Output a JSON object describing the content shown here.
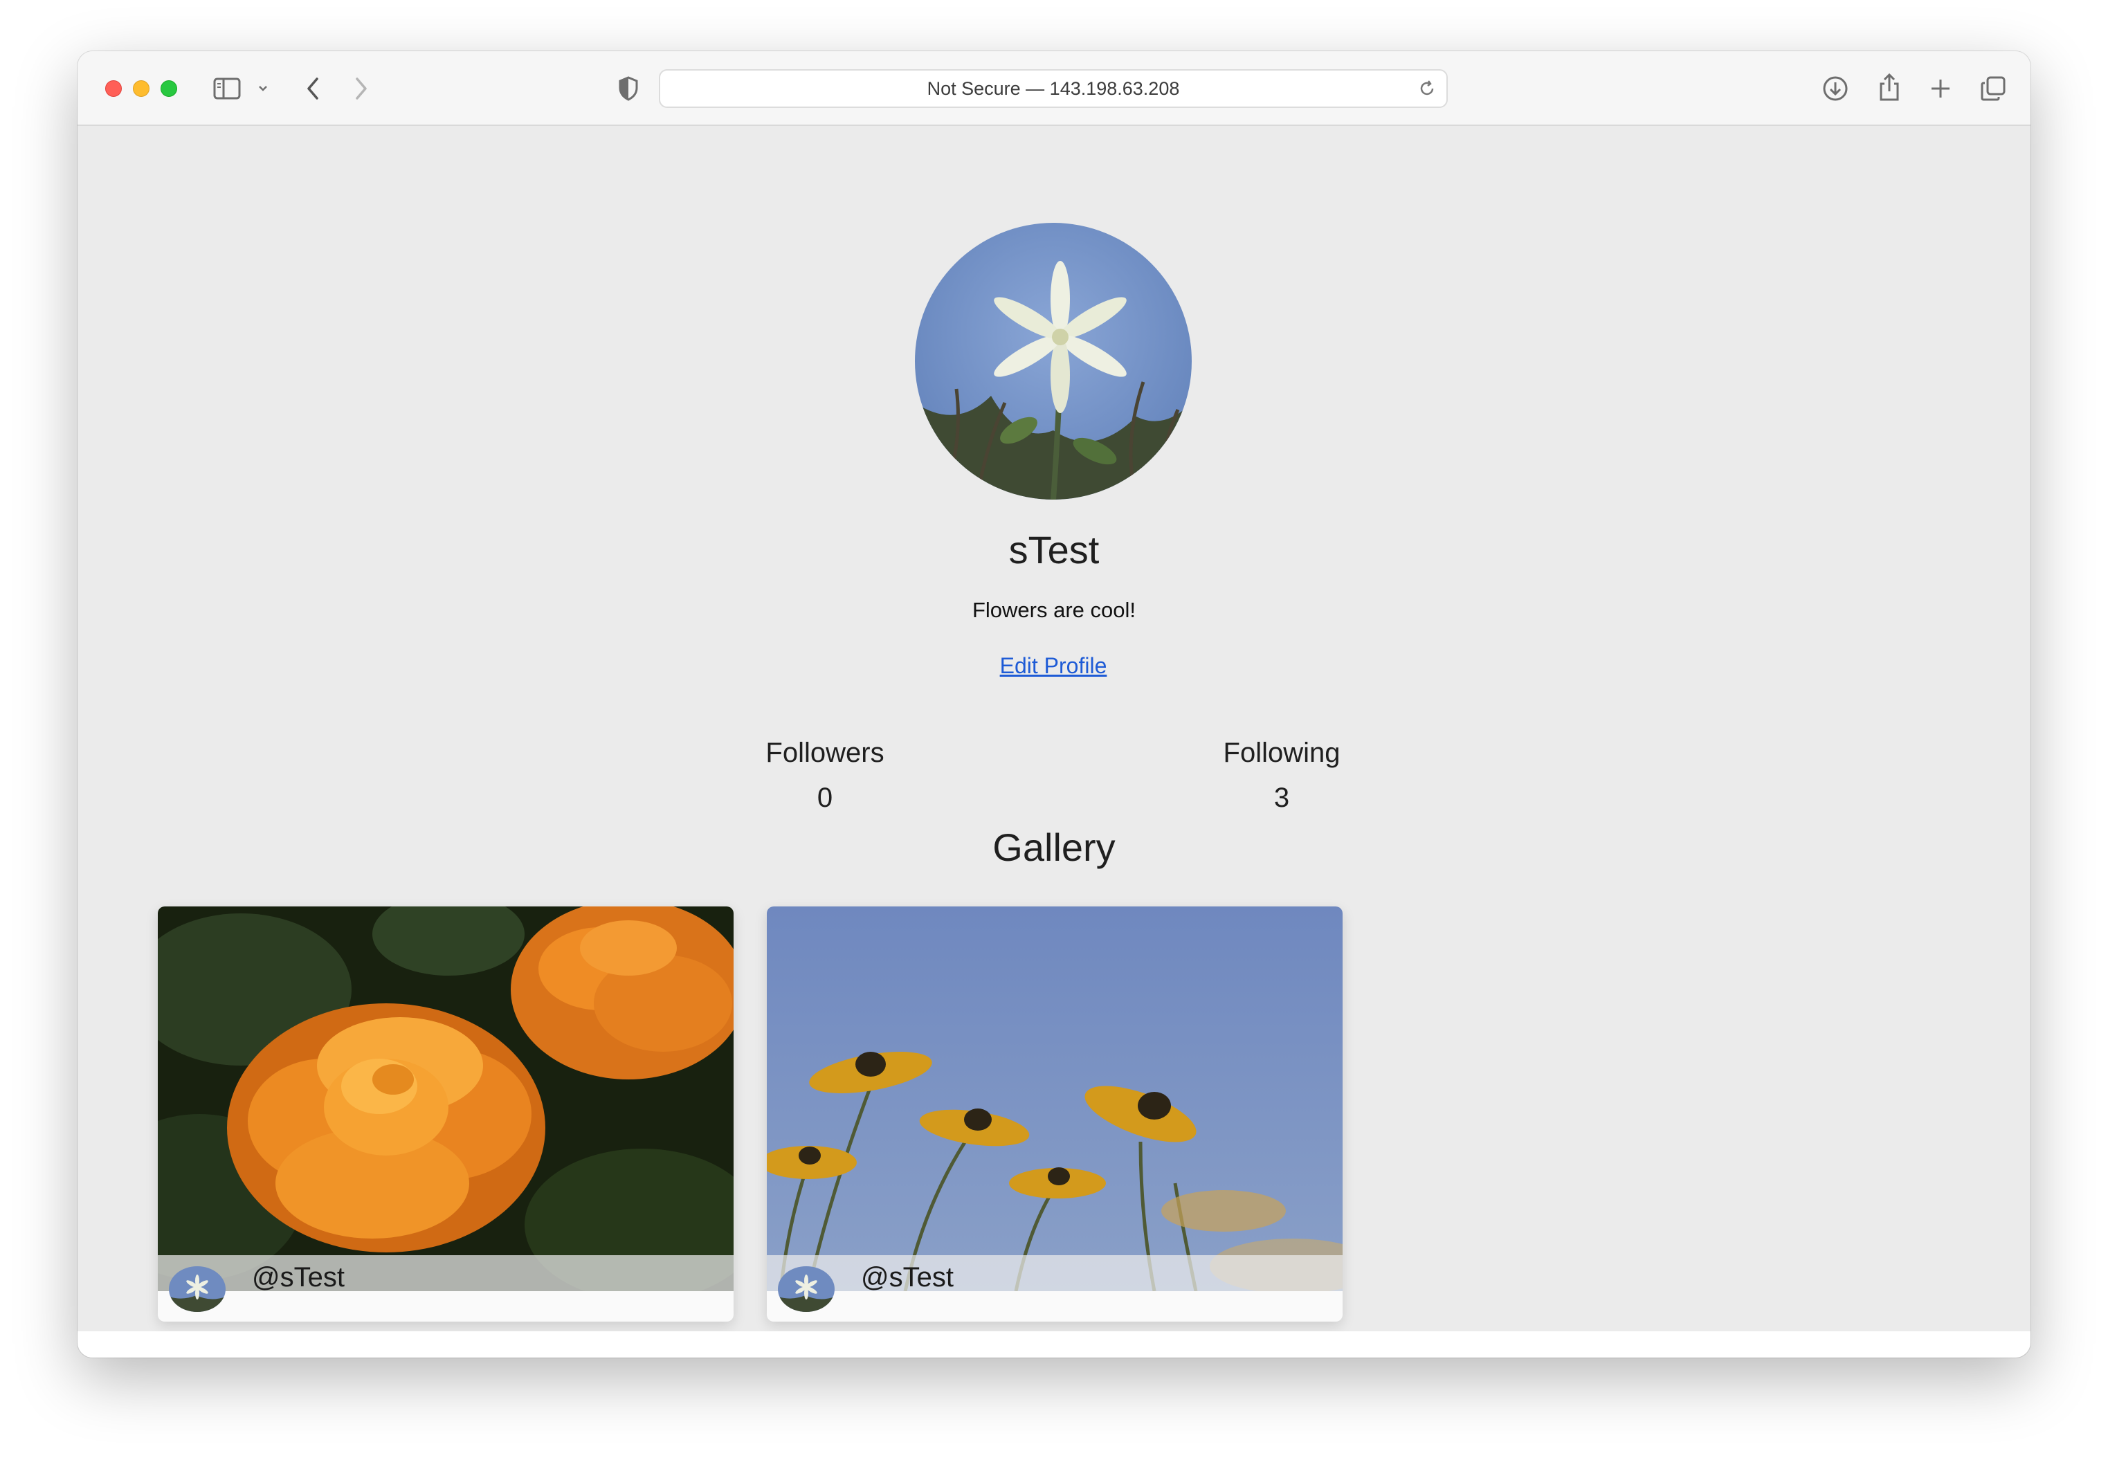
{
  "browser": {
    "address": "Not Secure — 143.198.63.208"
  },
  "profile": {
    "username": "sTest",
    "bio": "Flowers are cool!",
    "edit_link": "Edit Profile",
    "followers_label": "Followers",
    "followers_count": "0",
    "following_label": "Following",
    "following_count": "3"
  },
  "gallery": {
    "title": "Gallery",
    "posts": [
      {
        "author": "@sTest",
        "image": "orange-marigold-photo"
      },
      {
        "author": "@sTest",
        "image": "yellow-coneflowers-sky-photo"
      }
    ]
  },
  "colors": {
    "link": "#1e5bd6",
    "page_background": "#ebebeb"
  }
}
